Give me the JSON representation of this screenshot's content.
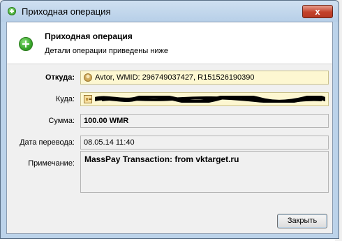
{
  "window": {
    "title": "Приходная операция",
    "close_glyph": "x"
  },
  "header": {
    "title": "Приходная операция",
    "subtitle": "Детали операции приведены ниже",
    "icon": "green-plus-icon"
  },
  "fields": {
    "from": {
      "label": "Откуда:",
      "value": "Avtor, WMID: 296749037427, R151526190390",
      "icon": "user-icon"
    },
    "to": {
      "label": "Куда:",
      "value": "",
      "icon": "card-icon",
      "redacted": true
    },
    "amount": {
      "label": "Сумма:",
      "value": "100.00 WMR"
    },
    "date": {
      "label": "Дата перевода:",
      "value": "08.05.14 11:40"
    },
    "note": {
      "label": "Примечание:",
      "value": "MassPay Transaction: from vktarget.ru"
    }
  },
  "buttons": {
    "close_label": "Закрыть"
  },
  "colors": {
    "titlebar": "#bcd3ea",
    "close_button": "#c3412a",
    "from_field_bg": "#fdf7d1"
  }
}
